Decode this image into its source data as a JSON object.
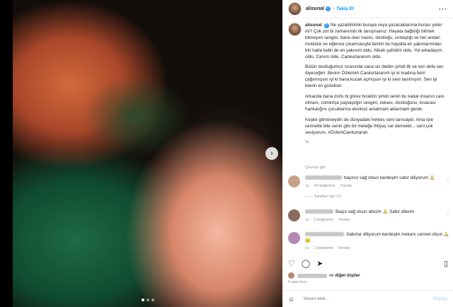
{
  "header": {
    "username": "alisunal",
    "follow_label": "Takip Et",
    "more_label": "···"
  },
  "caption": {
    "username": "alisunal",
    "paragraphs": [
      "Ne yazabilirimki buraya veya yazacaklarıma burası yeter mi? Çok zor bi zamanımdı ilk tanışmamız. Hayata bağlılığı bitmek bilmeyen sevgisi, bana olan inancı, dostluğu, sırdaşlığı ve her andan mutluluk ve eğlence çıkarmasıyla benim bu hayatta en yakınlarımdan biri hatta belki de en yakınım oldu. Nikah şahidim oldu. Yol arkadaşım oldu. Canım oldu. Cankurtaranım oldu.",
      "Bütün dostluğumuz sırasında sana siz dedim şimdi ilk ve son defa sen diyeceğim. Benim Özlemim Cankurtaranım iyi ki inadına beni çağırmışsın iyi ki bana kucak açmışsın iyi ki seni tanımışım. Sen iyi kilerin en güzelisin.",
      "Arkanda bana zorlu bi görev bıraktın şimdi senin bu kadar insanın canı olmanı, cömertçe paylaştığın sevgini, zekanı, dostluğunu, kısacası harikalığını çocuklarına eksiksiz anlatmam aktarmam gerek.",
      "Keşke gitmeseydin de dünyadaki herkes seni tanısaydı. Ama işte cennette bile senin gibi bir meleğe ihtiyaç var demekki... seni çok seviyorum. #ÖzlemCankurtaran"
    ],
    "timestamp": "9s",
    "translation_label": "Çeviriyi gör"
  },
  "comments": [
    {
      "text": "başınız sağ olsun kardeşim sabır diliyorum 🙏",
      "age": "1s",
      "likes": "42 beğenme",
      "reply": "Yanıtla",
      "replies_label": "—— Yanıtları gör (1)"
    },
    {
      "text": "Başın sağ olsun abicim 🙏 Sabır dilerim",
      "age": "1s",
      "likes": "5 beğenme",
      "reply": "Yanıtla"
    },
    {
      "text": "Sabırlar diliyorum kardeşim mekanı cennet olsun 🙏😔",
      "age": "1s",
      "likes": "1 beğenme",
      "reply": "Yanıtla"
    }
  ],
  "likes": {
    "suffix": "ve diğer kişiler",
    "prefix_word": "ve",
    "others": "diğer kişiler"
  },
  "date": "5 saat önce",
  "add_comment": {
    "placeholder": "Yorum ekle...",
    "post_label": "Paylaş"
  },
  "icons": [
    "heart-icon",
    "comment-icon",
    "share-icon",
    "bookmark-icon",
    "emoji-icon",
    "more-icon",
    "next-arrow-icon"
  ]
}
